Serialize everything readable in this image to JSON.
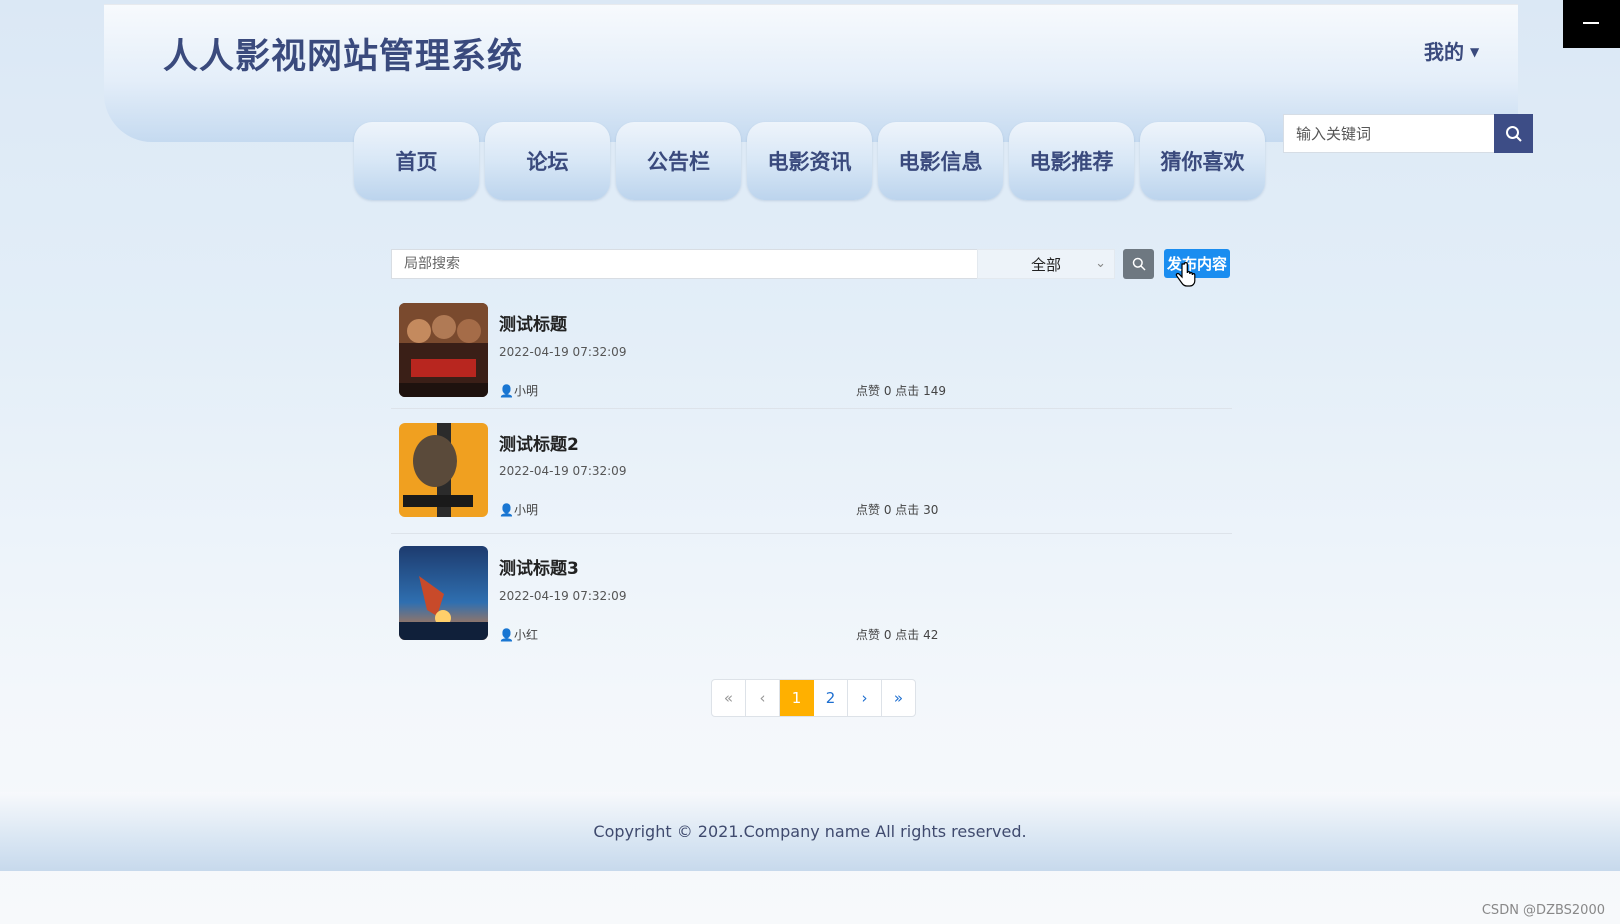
{
  "header": {
    "site_title": "人人影视网站管理系统",
    "user_menu": "我的"
  },
  "nav": {
    "items": [
      "首页",
      "论坛",
      "公告栏",
      "电影资讯",
      "电影信息",
      "电影推荐",
      "猜你喜欢"
    ]
  },
  "global_search": {
    "placeholder": "输入关键词"
  },
  "filter": {
    "search_placeholder": "局部搜索",
    "select_value": "全部",
    "publish_label": "发布内容"
  },
  "posts": [
    {
      "title": "测试标题",
      "time": "2022-04-19 07:32:09",
      "author": "小明",
      "stats": "点赞 0 点击 149"
    },
    {
      "title": "测试标题2",
      "time": "2022-04-19 07:32:09",
      "author": "小明",
      "stats": "点赞 0 点击 30"
    },
    {
      "title": "测试标题3",
      "time": "2022-04-19 07:32:09",
      "author": "小红",
      "stats": "点赞 0 点击 42"
    }
  ],
  "pagination": {
    "first": "«",
    "prev": "‹",
    "pages": [
      "1",
      "2"
    ],
    "next": "›",
    "last": "»",
    "current": "1"
  },
  "footer": {
    "copyright": "Copyright © 2021.Company name All rights reserved."
  },
  "watermark": "CSDN @DZBS2000",
  "colors": {
    "accent": "#3d4d86",
    "publish": "#1a8df0",
    "active_page": "#ffb000"
  }
}
